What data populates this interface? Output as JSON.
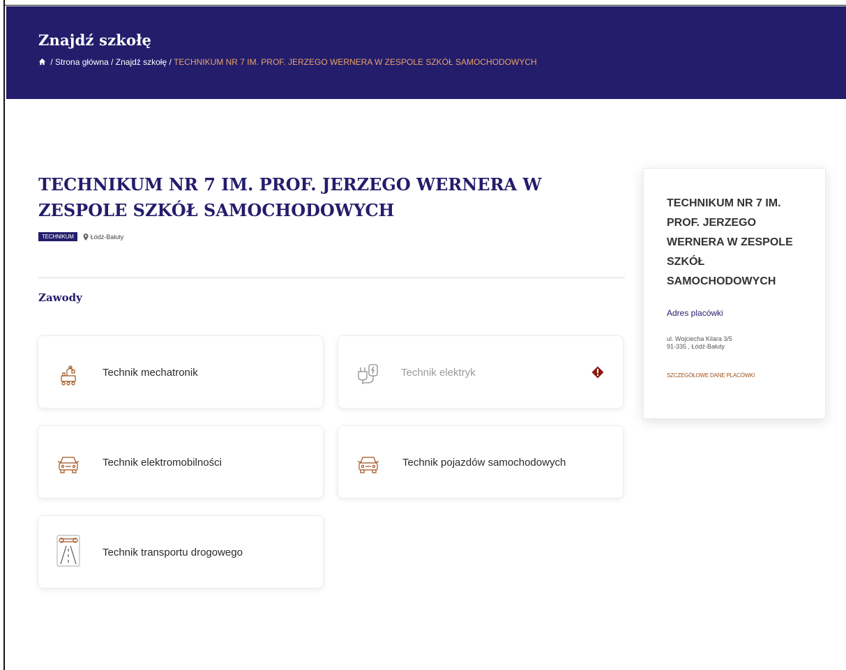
{
  "header": {
    "title": "Znajdź szkołę",
    "breadcrumb": {
      "home_link": "Strona główna",
      "find_link": "Znajdź szkołę",
      "separator": "/",
      "current": "TECHNIKUM NR 7 IM. PROF. JERZEGO WERNERA W ZESPOLE SZKÓŁ SAMOCHODOWYCH"
    }
  },
  "school": {
    "title": "TECHNIKUM NR 7 IM. PROF. JERZEGO WERNERA W ZESPOLE SZKÓŁ SAMOCHODOWYCH",
    "type_badge": "TECHNIKUM",
    "location": "Łódź-Bałuty"
  },
  "professions": {
    "heading": "Zawody",
    "items": [
      {
        "label": "Technik mechatronik",
        "icon": "mechatronics-icon"
      },
      {
        "label": "Technik elektryk",
        "icon": "electric-plug-icon",
        "warning": true
      },
      {
        "label": "Technik elektromobilności",
        "icon": "car-icon"
      },
      {
        "label": "Technik pojazdów samochodowych",
        "icon": "car-icon"
      },
      {
        "label": "Technik transportu drogowego",
        "icon": "road-wrench-icon"
      }
    ]
  },
  "sidebar": {
    "title": "TECHNIKUM NR 7 IM. PROF. JERZEGO WERNERA W ZESPOLE SZKÓŁ SAMOCHODOWYCH",
    "address_heading": "Adres placówki",
    "address_line1": "ul. Wojciecha Kilara 3/5",
    "address_line2": "91-335 , Łódź-Bałuty",
    "details_link": "SZCZEGÓŁOWE DANE PLACÓWKI"
  },
  "colors": {
    "brand_navy": "#231d6b",
    "accent_orange": "#e8a36a",
    "icon_brown": "#a0521a",
    "warning_red": "#8b1a0f"
  }
}
